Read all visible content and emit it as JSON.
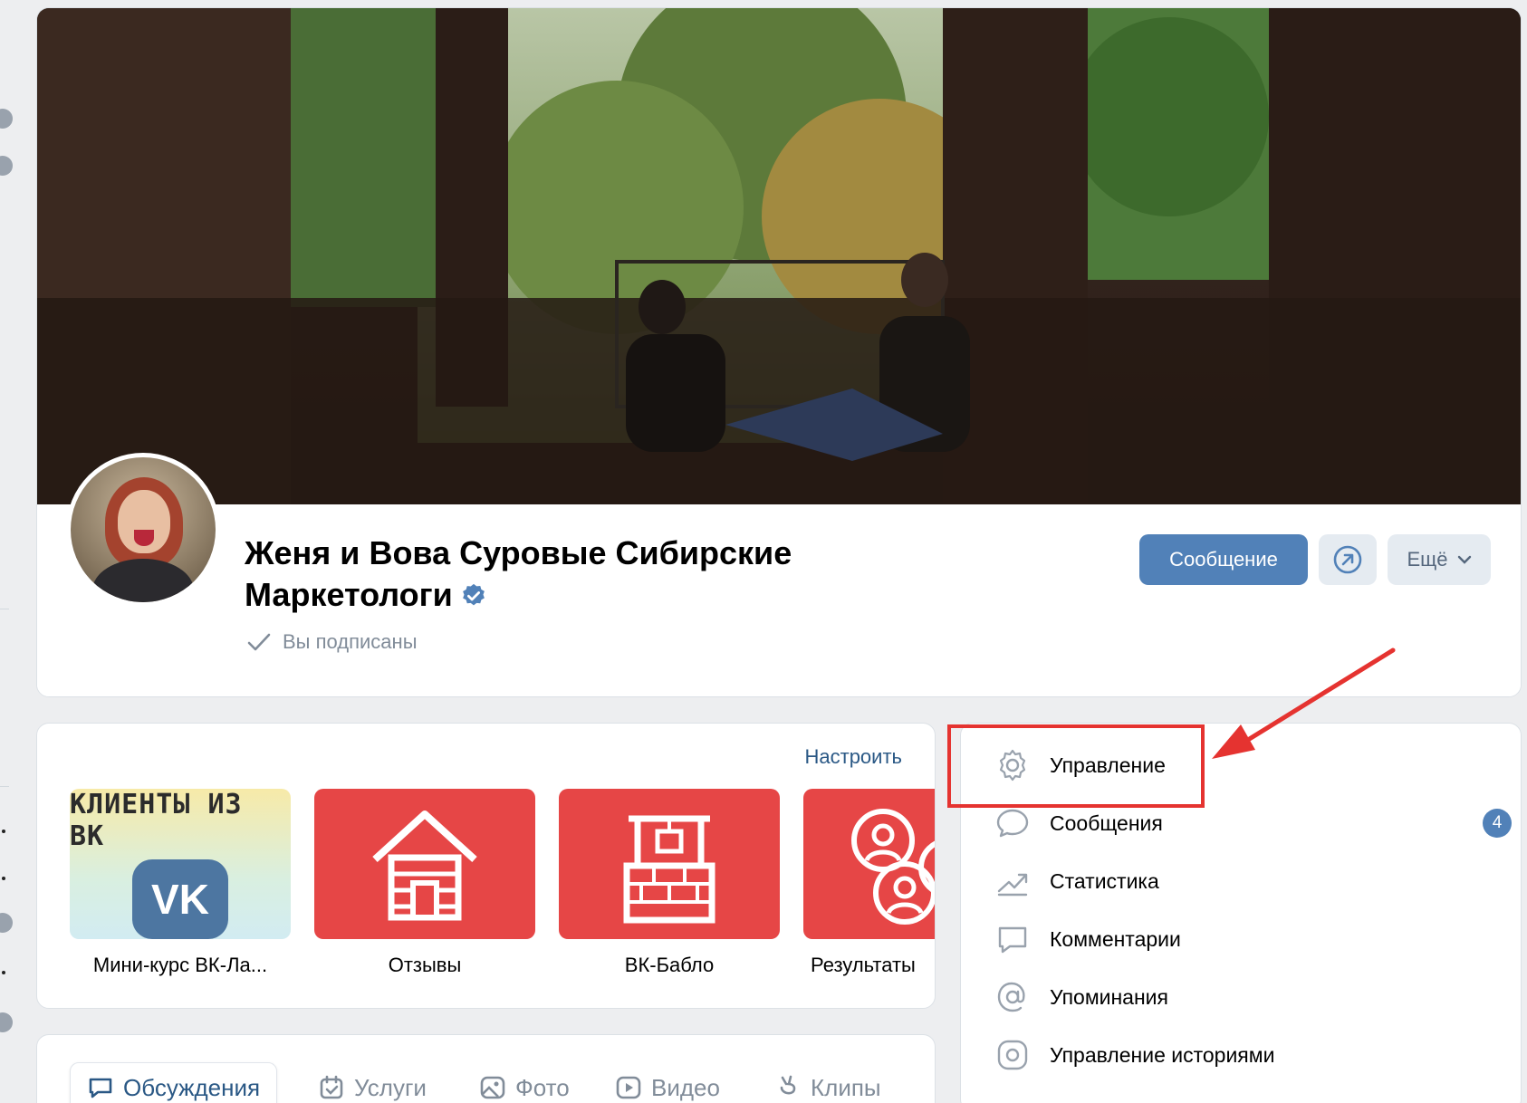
{
  "group": {
    "title": "Женя и Вова Суровые Сибирские Маркетологи",
    "subscription_status": "Вы подписаны",
    "verified_icon": "verified-badge-icon"
  },
  "actions": {
    "message_label": "Сообщение",
    "share_icon": "share-arrow-icon",
    "more_label": "Ещё"
  },
  "services": {
    "setup_label": "Настроить",
    "items": [
      {
        "label": "Мини-курс ВК-Ла...",
        "cover_title": "КЛИЕНТЫ ИЗ ВК",
        "cover_logo": "VK"
      },
      {
        "label": "Отзывы",
        "icon": "house-icon"
      },
      {
        "label": "ВК-Бабло",
        "icon": "well-icon"
      },
      {
        "label": "Результаты",
        "icon": "people-icon"
      }
    ]
  },
  "tabs": [
    {
      "label": "Обсуждения",
      "icon": "discussion-icon",
      "active": true
    },
    {
      "label": "Услуги",
      "icon": "calendar-check-icon",
      "active": false
    },
    {
      "label": "Фото",
      "icon": "photo-icon",
      "active": false
    },
    {
      "label": "Видео",
      "icon": "video-icon",
      "active": false
    },
    {
      "label": "Клипы",
      "icon": "clips-icon",
      "active": false
    }
  ],
  "menu": {
    "items": [
      {
        "label": "Управление",
        "icon": "gear-icon"
      },
      {
        "label": "Сообщения",
        "icon": "message-bubble-icon",
        "badge": "4"
      },
      {
        "label": "Статистика",
        "icon": "trend-chart-icon"
      },
      {
        "label": "Комментарии",
        "icon": "comment-icon"
      },
      {
        "label": "Упоминания",
        "icon": "at-sign-icon"
      },
      {
        "label": "Управление историями",
        "icon": "stories-icon"
      }
    ]
  },
  "colors": {
    "accent": "#5181b8",
    "link": "#2a5885",
    "annotation": "#e53330",
    "tile_red": "#e64646"
  }
}
